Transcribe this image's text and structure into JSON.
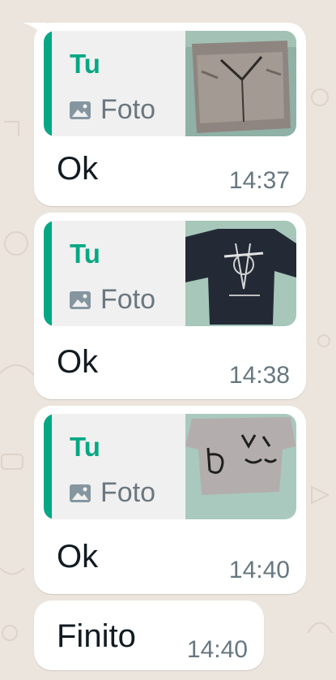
{
  "colors": {
    "background": "#ece5dd",
    "bubble": "#ffffff",
    "quote_background": "#f0f0f0",
    "quote_accent": "#06a884",
    "time_text": "#667781"
  },
  "messages": [
    {
      "quoted_name": "Tu",
      "quoted_media_icon": "image-icon",
      "quoted_media_label": "Foto",
      "thumbnail": "photo of grey-brown shorts on blue fabric",
      "text": "Ok",
      "time": "14:37"
    },
    {
      "quoted_name": "Tu",
      "quoted_media_icon": "image-icon",
      "quoted_media_label": "Foto",
      "thumbnail": "photo of dark navy printed t-shirt",
      "text": "Ok",
      "time": "14:38"
    },
    {
      "quoted_name": "Tu",
      "quoted_media_icon": "image-icon",
      "quoted_media_label": "Foto",
      "thumbnail": "photo of light grey t-shirt with black graphic",
      "text": "Ok",
      "time": "14:40"
    }
  ],
  "last_message": {
    "text": "Finito",
    "time": "14:40"
  }
}
